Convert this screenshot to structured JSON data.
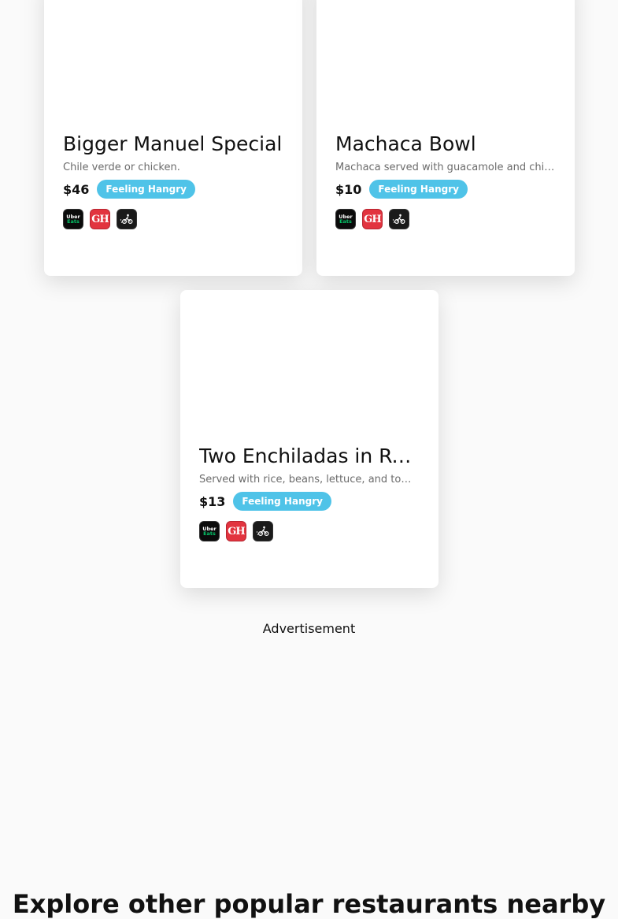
{
  "cards": [
    {
      "name": "Bigger Manuel Special",
      "description": "Chile verde or chicken.",
      "price": "$46",
      "badge": "Feeling Hangry",
      "services": [
        "Uber Eats",
        "GH",
        "Postmates"
      ]
    },
    {
      "name": "Machaca Bowl",
      "description": "Machaca served with guacamole and chips.",
      "price": "$10",
      "badge": "Feeling Hangry",
      "services": [
        "Uber Eats",
        "GH",
        "Postmates"
      ]
    },
    {
      "name": "Two Enchiladas in Red Sauce",
      "description": "Served with rice, beans, lettuce, and tomato.",
      "price": "$13",
      "badge": "Feeling Hangry",
      "services": [
        "Uber Eats",
        "GH",
        "Postmates"
      ]
    }
  ],
  "service_logos": {
    "uber_line1": "Uber",
    "uber_line2": "Eats",
    "grubhub": "GH"
  },
  "colors": {
    "badge": "#4fc3e8",
    "grubhub": "#e2343f",
    "uber_green": "#06c167",
    "background": "#fafafa"
  },
  "advertisement_label": "Advertisement",
  "explore_heading": "Explore other popular restaurants nearby"
}
